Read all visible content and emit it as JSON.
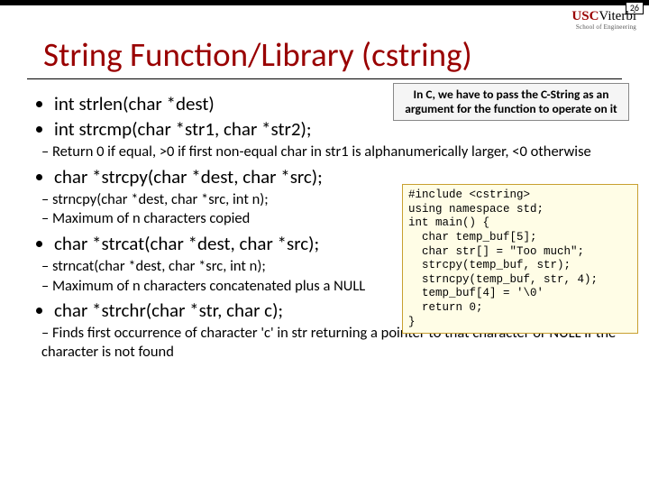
{
  "page_number": "26",
  "brand": {
    "usc": "USC",
    "viterbi": "Viterbi",
    "sub": "School of Engineering"
  },
  "title": "String Function/Library (cstring)",
  "callout": "In C, we have to pass the C-String as an argument for the function to operate on it",
  "bullets": {
    "b1": "int strlen(char *dest)",
    "b2": "int strcmp(char *str1, char *str2);",
    "b2s1": "Return 0 if equal, >0 if first non-equal char in str1 is alphanumerically larger, <0 otherwise",
    "b3": "char *strcpy(char *dest, char *src);",
    "b3s1": "strncpy(char *dest, char *src, int n);",
    "b3s2": "Maximum of n characters copied",
    "b4": "char *strcat(char *dest, char *src);",
    "b4s1": "strncat(char *dest, char *src, int n);",
    "b4s2": "Maximum of n characters concatenated plus a NULL",
    "b5": "char *strchr(char *str, char c);",
    "b5s1": "Finds first occurrence of character 'c' in str returning a pointer to that character or NULL if the character is not found"
  },
  "code": "#include <cstring>\nusing namespace std;\nint main() {\n  char temp_buf[5];\n  char str[] = \"Too much\";\n  strcpy(temp_buf, str);\n  strncpy(temp_buf, str, 4);\n  temp_buf[4] = '\\0'\n  return 0;\n}"
}
